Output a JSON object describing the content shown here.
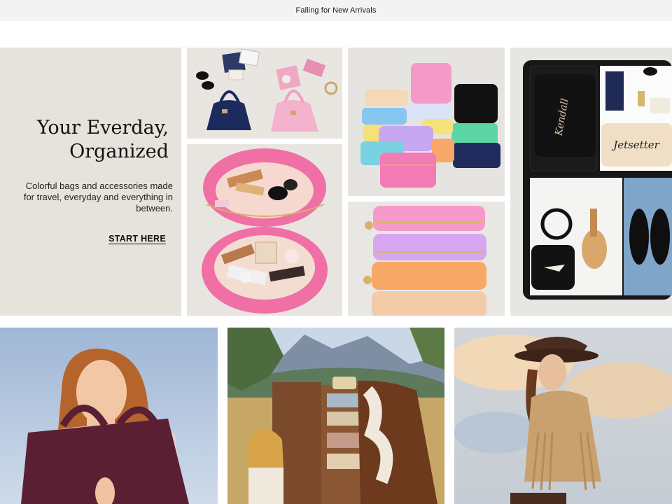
{
  "announcement": {
    "text": "Falling for New Arrivals"
  },
  "hero": {
    "title_line1": "Your Everday,",
    "title_line2": "Organized",
    "description": "Colorful bags and accessories made for travel, everyday and everything in between.",
    "cta_label": "START HERE"
  },
  "images": {
    "flatlay_bags": "flatlay-handbags-photo",
    "open_cosmetic_case": "open-cosmetic-case-photo",
    "pouch_stack": "stacked-pouches-photo",
    "pouch_stack_closeup": "stacked-pouches-closeup-photo",
    "suitcase": "packed-suitcase-photo",
    "suitcase_pouch_text_1": "Kendall",
    "suitcase_pouch_text_2": "Jetsetter",
    "model_tote": "model-with-suede-tote-photo",
    "model_field": "model-in-field-with-cabinet-photo",
    "model_cowboy": "model-in-fringe-jacket-photo"
  },
  "colors": {
    "announcement_bg": "#f4f3f3",
    "hero_bg": "#e6e3dc"
  }
}
